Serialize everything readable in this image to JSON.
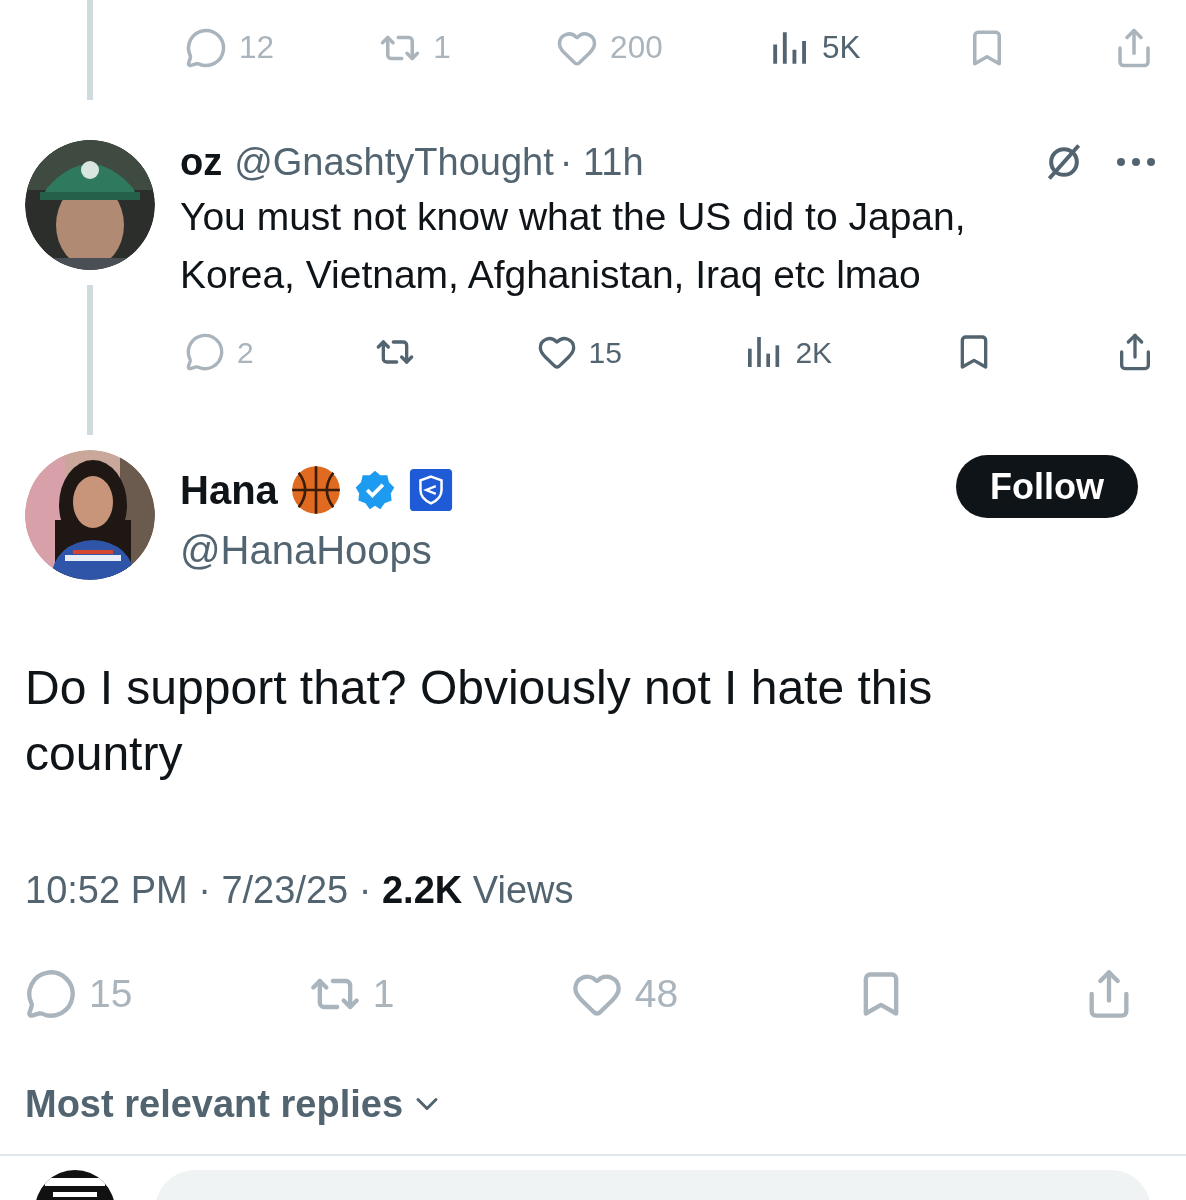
{
  "previous_tweet": {
    "actions": [
      {
        "kind": "reply",
        "count": "12",
        "dimmed": true
      },
      {
        "kind": "repost",
        "count": "1",
        "dimmed": true
      },
      {
        "kind": "like",
        "count": "200",
        "dimmed": true
      },
      {
        "kind": "views",
        "count": "5K",
        "dimmed": false
      },
      {
        "kind": "bookmark",
        "dimmed": true
      },
      {
        "kind": "share",
        "dimmed": true
      }
    ]
  },
  "reply_tweet": {
    "name": "oz",
    "handle": "@GnashtyThought",
    "time": "· 11h",
    "text": "You must not know what the US did to Japan, Korea, Vietnam, Afghanistan, Iraq etc lmao",
    "actions": [
      {
        "kind": "reply",
        "count": "2",
        "dimmed": true
      },
      {
        "kind": "repost",
        "dimmed": false
      },
      {
        "kind": "like",
        "count": "15",
        "dimmed": false
      },
      {
        "kind": "views",
        "count": "2K",
        "dimmed": false
      },
      {
        "kind": "bookmark",
        "dimmed": false
      },
      {
        "kind": "share",
        "dimmed": false
      }
    ]
  },
  "main_tweet": {
    "name": "Hana",
    "handle": "@HanaHoops",
    "follow_button": "Follow",
    "text": "Do I support that? Obviously not I hate this country",
    "meta": "10:52 PM · 7/23/25 · **2.2K** Views",
    "actions": [
      {
        "kind": "reply",
        "count": "15",
        "dimmed": true
      },
      {
        "kind": "repost",
        "count": "1",
        "dimmed": true
      },
      {
        "kind": "like",
        "count": "48",
        "dimmed": true
      },
      {
        "kind": "bookmark",
        "dimmed": true
      },
      {
        "kind": "share",
        "dimmed": true
      }
    ]
  },
  "replies_sort": "Most relevant replies"
}
